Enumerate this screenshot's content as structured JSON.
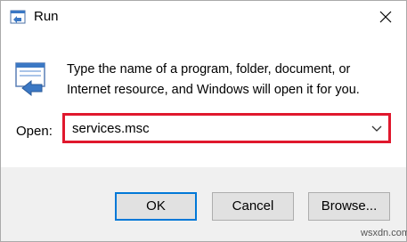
{
  "window": {
    "title": "Run",
    "title_icon": "run-icon",
    "close_icon": "close-icon"
  },
  "description": {
    "line1": "Type the name of a program, folder, document, or",
    "line2": "Internet resource, and Windows will open it for you."
  },
  "open": {
    "label_prefix": "Open:",
    "value": "services.msc",
    "dropdown_icon": "chevron-down-icon",
    "highlight_color": "#e0182d"
  },
  "buttons": {
    "ok_label": "OK",
    "cancel_label": "Cancel",
    "browse_label": "Browse..."
  },
  "accent_color": "#0078d7",
  "watermark": "wsxdn.com"
}
